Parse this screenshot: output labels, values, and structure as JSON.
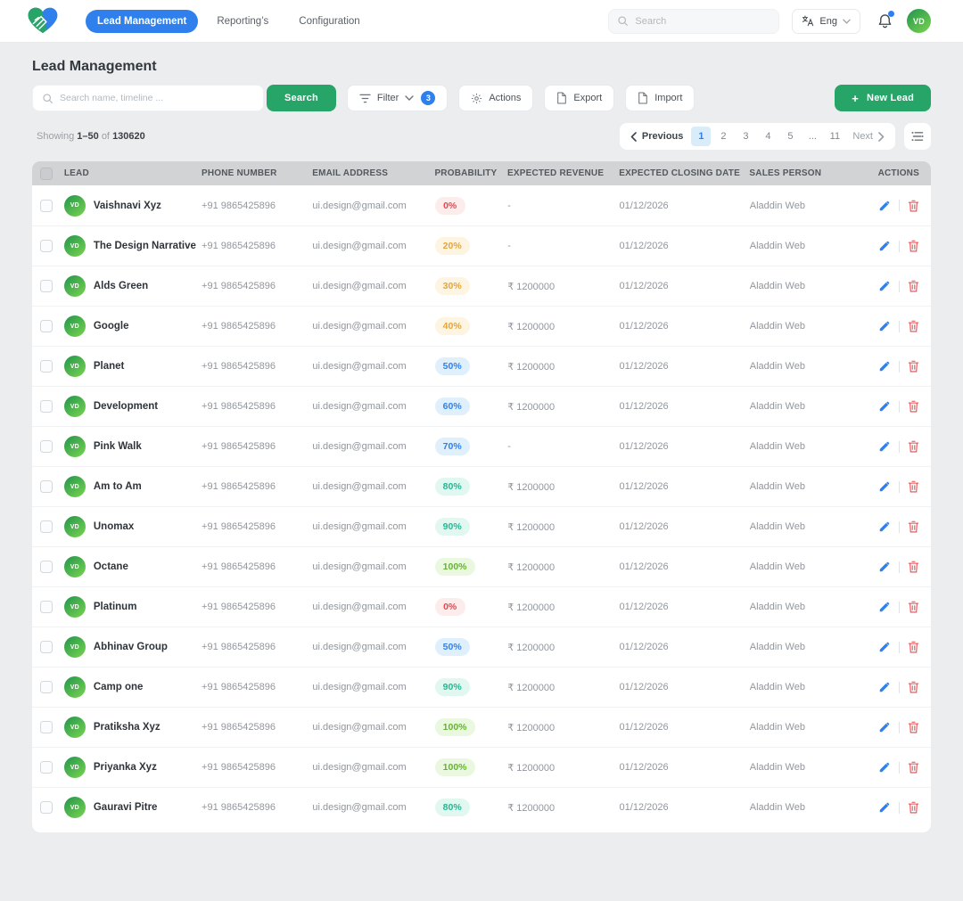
{
  "topbar": {
    "nav": [
      {
        "label": "Lead Management",
        "active": true
      },
      {
        "label": "Reporting’s",
        "active": false
      },
      {
        "label": "Configuration",
        "active": false
      }
    ],
    "search_placeholder": "Search",
    "language": "Eng",
    "avatar_initials": "VD"
  },
  "page": {
    "title": "Lead Management"
  },
  "toolbar": {
    "search_placeholder": "Search name, timeline ...",
    "search_label": "Search",
    "filter_label": "Filter",
    "filter_count": "3",
    "actions_label": "Actions",
    "export_label": "Export",
    "import_label": "Import",
    "new_lead_plus": "+",
    "new_lead_label": "New Lead"
  },
  "summary": {
    "showing_label": "Showing",
    "range": "1–50",
    "of_label": "of",
    "total": "130620"
  },
  "pagination": {
    "previous": "Previous",
    "pages": [
      "1",
      "2",
      "3",
      "4",
      "5",
      "...",
      "11"
    ],
    "active_page": "1",
    "next": "Next"
  },
  "table": {
    "headers": [
      "LEAD",
      "PHONE NUMBER",
      "EMAIL ADDRESS",
      "PROBABILITY",
      "EXPECTED REVENUE",
      "EXPECTED CLOSING DATE",
      "SALES PERSON",
      "ACTIONS"
    ],
    "rows": [
      {
        "initials": "VD",
        "name": "Vaishnavi Xyz",
        "phone": "+91 9865425896",
        "email": "ui.design@gmail.com",
        "probability": "0%",
        "level": "red",
        "revenue": "-",
        "closing_date": "01/12/2026",
        "sales_person": "Aladdin Web"
      },
      {
        "initials": "VD",
        "name": "The Design Narrative",
        "phone": "+91 9865425896",
        "email": "ui.design@gmail.com",
        "probability": "20%",
        "level": "yellow",
        "revenue": "-",
        "closing_date": "01/12/2026",
        "sales_person": "Aladdin Web"
      },
      {
        "initials": "VD",
        "name": "Alds Green",
        "phone": "+91 9865425896",
        "email": "ui.design@gmail.com",
        "probability": "30%",
        "level": "yellow",
        "revenue": "₹ 1200000",
        "closing_date": "01/12/2026",
        "sales_person": "Aladdin Web"
      },
      {
        "initials": "VD",
        "name": "Google",
        "phone": "+91 9865425896",
        "email": "ui.design@gmail.com",
        "probability": "40%",
        "level": "yellow",
        "revenue": "₹ 1200000",
        "closing_date": "01/12/2026",
        "sales_person": "Aladdin Web"
      },
      {
        "initials": "VD",
        "name": "Planet",
        "phone": "+91 9865425896",
        "email": "ui.design@gmail.com",
        "probability": "50%",
        "level": "blue",
        "revenue": "₹ 1200000",
        "closing_date": "01/12/2026",
        "sales_person": "Aladdin Web"
      },
      {
        "initials": "VD",
        "name": "Development",
        "phone": "+91 9865425896",
        "email": "ui.design@gmail.com",
        "probability": "60%",
        "level": "blue",
        "revenue": "₹ 1200000",
        "closing_date": "01/12/2026",
        "sales_person": "Aladdin Web"
      },
      {
        "initials": "VD",
        "name": "Pink Walk",
        "phone": "+91 9865425896",
        "email": "ui.design@gmail.com",
        "probability": "70%",
        "level": "blue",
        "revenue": "-",
        "closing_date": "01/12/2026",
        "sales_person": "Aladdin Web"
      },
      {
        "initials": "VD",
        "name": "Am to Am",
        "phone": "+91 9865425896",
        "email": "ui.design@gmail.com",
        "probability": "80%",
        "level": "teal",
        "revenue": "₹ 1200000",
        "closing_date": "01/12/2026",
        "sales_person": "Aladdin Web"
      },
      {
        "initials": "VD",
        "name": "Unomax",
        "phone": "+91 9865425896",
        "email": "ui.design@gmail.com",
        "probability": "90%",
        "level": "teal",
        "revenue": "₹ 1200000",
        "closing_date": "01/12/2026",
        "sales_person": "Aladdin Web"
      },
      {
        "initials": "VD",
        "name": "Octane",
        "phone": "+91 9865425896",
        "email": "ui.design@gmail.com",
        "probability": "100%",
        "level": "green",
        "revenue": "₹ 1200000",
        "closing_date": "01/12/2026",
        "sales_person": "Aladdin Web"
      },
      {
        "initials": "VD",
        "name": "Platinum",
        "phone": "+91 9865425896",
        "email": "ui.design@gmail.com",
        "probability": "0%",
        "level": "red",
        "revenue": "₹ 1200000",
        "closing_date": "01/12/2026",
        "sales_person": "Aladdin Web"
      },
      {
        "initials": "VD",
        "name": "Abhinav Group",
        "phone": "+91 9865425896",
        "email": "ui.design@gmail.com",
        "probability": "50%",
        "level": "blue",
        "revenue": "₹ 1200000",
        "closing_date": "01/12/2026",
        "sales_person": "Aladdin Web"
      },
      {
        "initials": "VD",
        "name": "Camp one",
        "phone": "+91 9865425896",
        "email": "ui.design@gmail.com",
        "probability": "90%",
        "level": "teal",
        "revenue": "₹ 1200000",
        "closing_date": "01/12/2026",
        "sales_person": "Aladdin Web"
      },
      {
        "initials": "VD",
        "name": "Pratiksha Xyz",
        "phone": "+91 9865425896",
        "email": "ui.design@gmail.com",
        "probability": "100%",
        "level": "green",
        "revenue": "₹ 1200000",
        "closing_date": "01/12/2026",
        "sales_person": "Aladdin Web"
      },
      {
        "initials": "VD",
        "name": "Priyanka Xyz",
        "phone": "+91 9865425896",
        "email": "ui.design@gmail.com",
        "probability": "100%",
        "level": "green",
        "revenue": "₹ 1200000",
        "closing_date": "01/12/2026",
        "sales_person": "Aladdin Web"
      },
      {
        "initials": "VD",
        "name": "Gauravi Pitre",
        "phone": "+91 9865425896",
        "email": "ui.design@gmail.com",
        "probability": "80%",
        "level": "teal",
        "revenue": "₹ 1200000",
        "closing_date": "01/12/2026",
        "sales_person": "Aladdin Web"
      }
    ]
  },
  "colors": {
    "accent_blue": "#2f80ed",
    "accent_green": "#27a468",
    "badge_red": "#e5484d",
    "badge_yellow": "#e3a63b",
    "badge_blue": "#2f80ed",
    "badge_teal": "#23b893",
    "badge_green": "#64b52e"
  }
}
